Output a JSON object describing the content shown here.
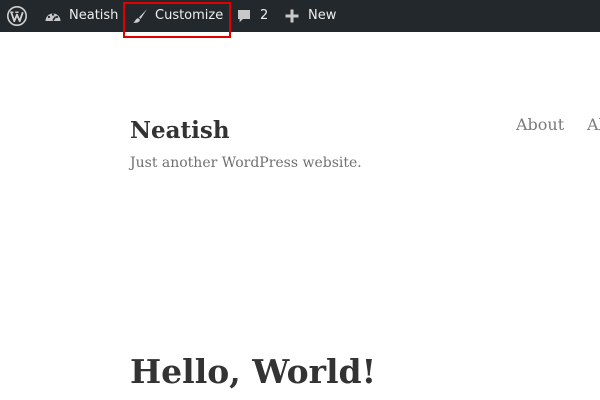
{
  "admin_bar": {
    "wp_logo_icon": "wordpress-logo-icon",
    "site_name": "Neatish",
    "site_icon": "dashboard-icon",
    "customize_label": "Customize",
    "customize_icon": "paintbrush-icon",
    "comments_count": "2",
    "comments_icon": "speech-bubble-icon",
    "new_label": "New",
    "new_icon": "plus-icon",
    "background_color": "#23282d",
    "highlight_color": "#e00000"
  },
  "header": {
    "site_title": "Neatish",
    "tagline": "Just another WordPress website."
  },
  "nav": {
    "items": [
      {
        "label": "About"
      },
      {
        "label": "Al"
      }
    ]
  },
  "main": {
    "post_title": "Hello, World!"
  }
}
